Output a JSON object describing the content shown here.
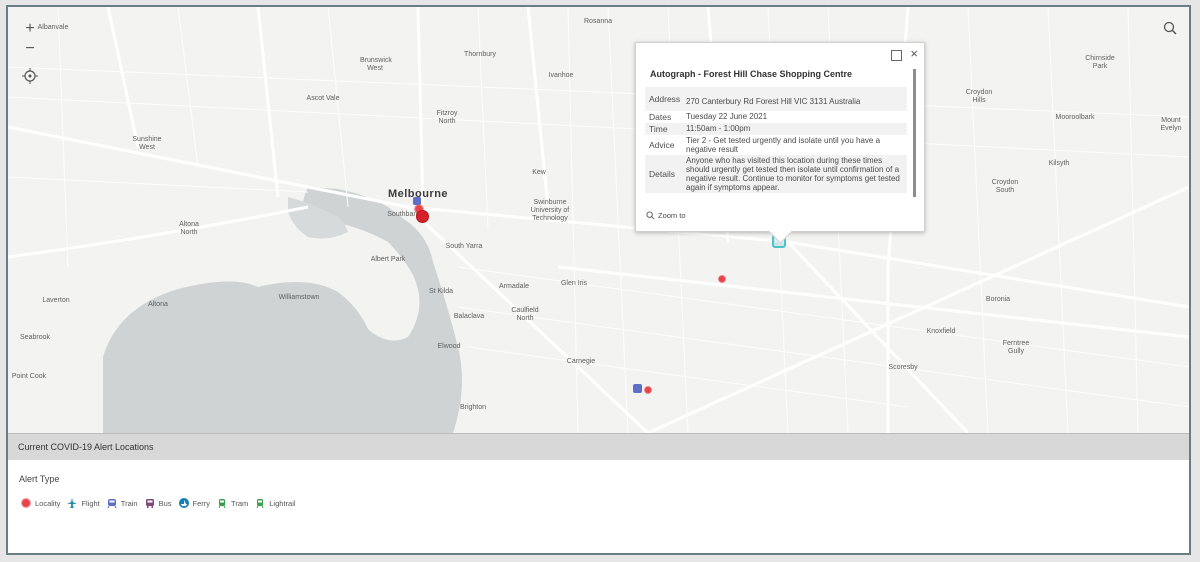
{
  "map": {
    "places": [
      {
        "name": "Albanvale",
        "kind": "suburb"
      },
      {
        "name": "Rosanna",
        "kind": "suburb"
      },
      {
        "name": "Thornbury",
        "kind": "suburb"
      },
      {
        "name": "Brunswick West",
        "kind": "suburb"
      },
      {
        "name": "Ivanhoe",
        "kind": "suburb"
      },
      {
        "name": "Chirnside Park",
        "kind": "suburb"
      },
      {
        "name": "Ascot Vale",
        "kind": "suburb"
      },
      {
        "name": "Fitzroy North",
        "kind": "suburb"
      },
      {
        "name": "Croydon Hills",
        "kind": "suburb"
      },
      {
        "name": "Mooroolbark",
        "kind": "suburb"
      },
      {
        "name": "Mount Evelyn",
        "kind": "suburb"
      },
      {
        "name": "Sunshine West",
        "kind": "suburb"
      },
      {
        "name": "Kew",
        "kind": "suburb"
      },
      {
        "name": "Kilsyth",
        "kind": "suburb"
      },
      {
        "name": "Melbourne",
        "kind": "city"
      },
      {
        "name": "Southbank",
        "kind": "suburb"
      },
      {
        "name": "Swinburne University of Technology",
        "kind": "poi"
      },
      {
        "name": "Croydon South",
        "kind": "suburb"
      },
      {
        "name": "Altona North",
        "kind": "suburb"
      },
      {
        "name": "South Yarra",
        "kind": "suburb"
      },
      {
        "name": "Albert Park",
        "kind": "suburb"
      },
      {
        "name": "Armadale",
        "kind": "suburb"
      },
      {
        "name": "Glen Iris",
        "kind": "suburb"
      },
      {
        "name": "Laverton",
        "kind": "suburb"
      },
      {
        "name": "Altona",
        "kind": "suburb"
      },
      {
        "name": "Williamstown",
        "kind": "suburb"
      },
      {
        "name": "St Kilda",
        "kind": "suburb"
      },
      {
        "name": "Boronia",
        "kind": "suburb"
      },
      {
        "name": "Caulfield North",
        "kind": "suburb"
      },
      {
        "name": "Balaclava",
        "kind": "suburb"
      },
      {
        "name": "Seabrook",
        "kind": "suburb"
      },
      {
        "name": "Knoxfield",
        "kind": "suburb"
      },
      {
        "name": "Ferntree Gully",
        "kind": "suburb"
      },
      {
        "name": "Elwood",
        "kind": "suburb"
      },
      {
        "name": "Carnegie",
        "kind": "suburb"
      },
      {
        "name": "Scoresby",
        "kind": "suburb"
      },
      {
        "name": "Point Cook",
        "kind": "suburb"
      },
      {
        "name": "Brighton",
        "kind": "suburb"
      }
    ],
    "controls": {
      "zoom_in": "+",
      "zoom_out": "−"
    }
  },
  "popup": {
    "title": "Autograph - Forest Hill Chase Shopping Centre",
    "fields": [
      {
        "key": "Address",
        "value": "270 Canterbury Rd Forest Hill VIC 3131 Australia"
      },
      {
        "key": "Dates",
        "value": "Tuesday 22 June 2021"
      },
      {
        "key": "Time",
        "value": "11:50am - 1:00pm"
      },
      {
        "key": "Advice",
        "value": "Tier 2 - Get tested urgently and isolate until you have a negative result"
      },
      {
        "key": "Details",
        "value": "Anyone who has visited this location during these times should urgently get tested then isolate until confirmation of a negative result. Continue to monitor for symptoms get tested again if symptoms appear."
      }
    ],
    "zoom_to": "Zoom to",
    "close": "×"
  },
  "panel": {
    "title": "Current COVID-19 Alert Locations",
    "legend_title": "Alert Type",
    "legend": [
      {
        "label": "Locality",
        "icon": "locality-icon",
        "color": "#e8434b"
      },
      {
        "label": "Flight",
        "icon": "plane-icon",
        "color": "#2a8fb0"
      },
      {
        "label": "Train",
        "icon": "train-icon",
        "color": "#5e6fc8"
      },
      {
        "label": "Bus",
        "icon": "bus-icon",
        "color": "#7d4a7a"
      },
      {
        "label": "Ferry",
        "icon": "ferry-icon",
        "color": "#1a7fb8"
      },
      {
        "label": "Tram",
        "icon": "tram-icon",
        "color": "#3aa14a"
      },
      {
        "label": "Lightrail",
        "icon": "lightrail-icon",
        "color": "#3aa14a"
      }
    ]
  },
  "colors": {
    "land": "#f3f3f1",
    "water": "#cfd3d4",
    "alert": "#e8434b",
    "selected": "#4fc1c9",
    "panel_header": "#d8d8d8"
  }
}
